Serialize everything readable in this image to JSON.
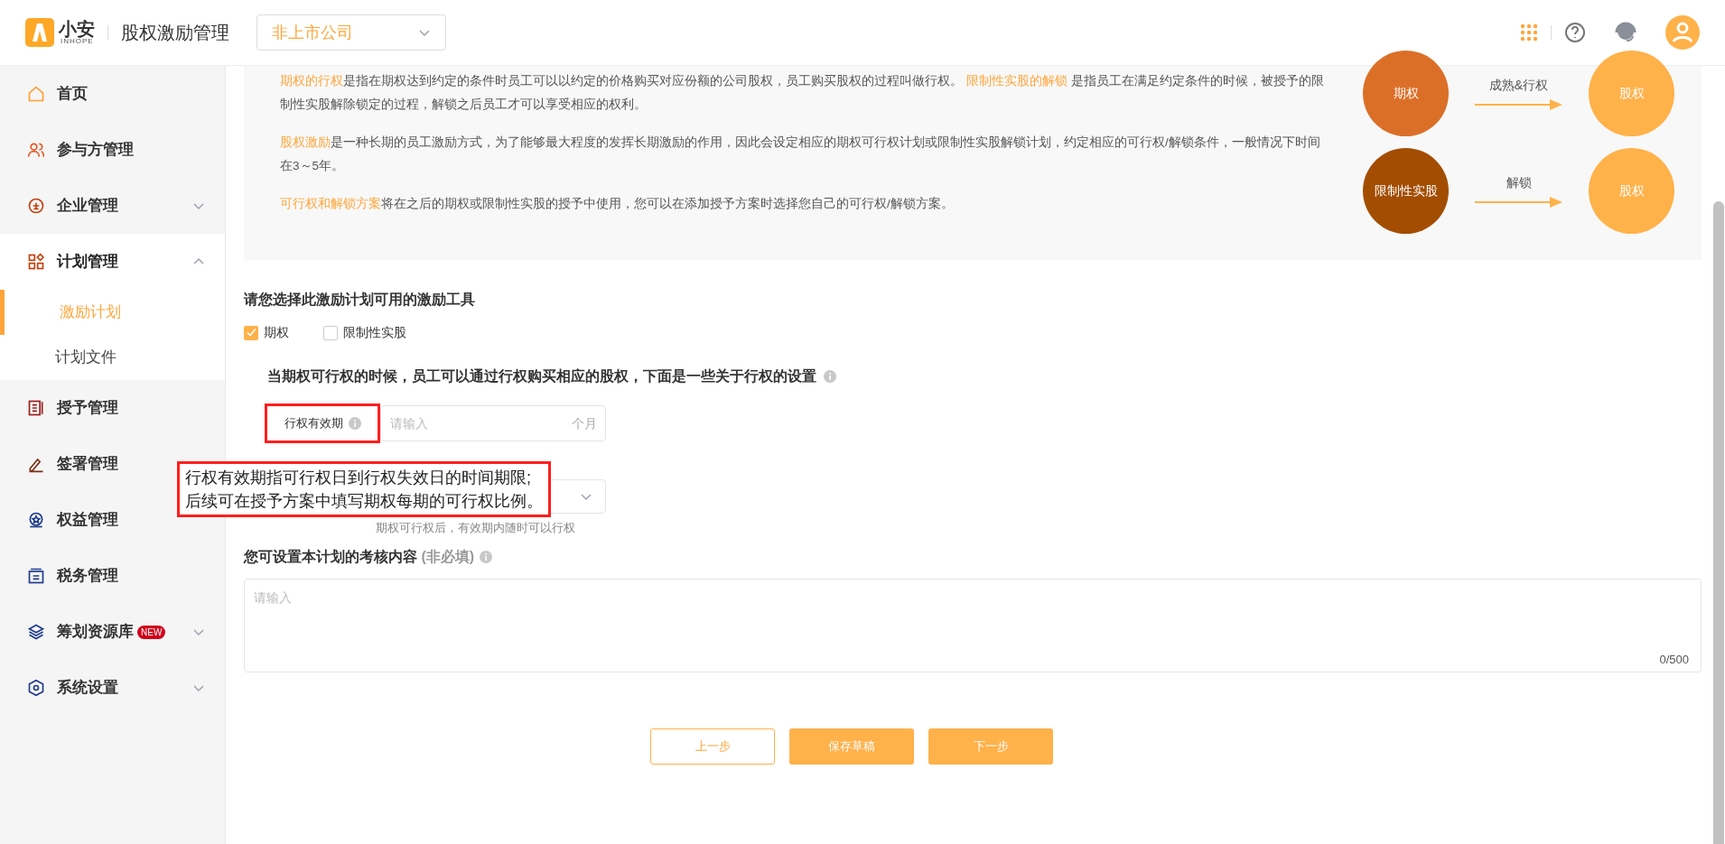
{
  "header": {
    "logo_text": "小安",
    "logo_sub": "INHOPE",
    "app_title": "股权激励管理",
    "company_select": "非上市公司"
  },
  "sidebar": [
    {
      "label": "首页",
      "selected": false
    },
    {
      "label": "参与方管理",
      "selected": false
    },
    {
      "label": "企业管理",
      "expanded": false,
      "selected": false
    },
    {
      "label": "计划管理",
      "expanded": true,
      "selected": false,
      "children": [
        {
          "label": "激励计划",
          "selected": true
        },
        {
          "label": "计划文件",
          "selected": false
        }
      ]
    },
    {
      "label": "授予管理",
      "selected": false
    },
    {
      "label": "签署管理",
      "expanded": false,
      "selected": false
    },
    {
      "label": "权益管理",
      "selected": false
    },
    {
      "label": "税务管理",
      "selected": false
    },
    {
      "label": "筹划资源库",
      "badge": "NEW",
      "expanded": false,
      "selected": false
    },
    {
      "label": "系统设置",
      "expanded": false,
      "selected": false
    }
  ],
  "intro": [
    [
      {
        "text": "期权的行权",
        "highlight": true
      },
      {
        "text": "是指在期权达到约定的条件时员工可以以约定的价格购买对应份额的公司股权，员工购买股权的过程叫做行权。 ",
        "highlight": false
      },
      {
        "text": "限制性实股的解锁",
        "highlight": true
      },
      {
        "text": " 是指员工在满足约定条件的时候，被授予的限制性实股解除锁定的过程，解锁之后员工才可以享受相应的权利。",
        "highlight": false
      }
    ],
    [
      {
        "text": "股权激励",
        "highlight": true
      },
      {
        "text": "是一种长期的员工激励方式，为了能够最大程度的发挥长期激励的作用，因此会设定相应的期权可行权计划或限制性实股解锁计划，约定相应的可行权/解锁条件，一般情况下时间在3～5年。",
        "highlight": false
      }
    ],
    [
      {
        "text": "可行权和解锁方案",
        "highlight": true
      },
      {
        "text": "将在之后的期权或限制性实股的授予中使用，您可以在添加授予方案时选择您自己的可行权/解锁方案。",
        "highlight": false
      }
    ]
  ],
  "diagram": [
    {
      "from": "期权",
      "arrow_label": "成熟&行权",
      "to": "股权"
    },
    {
      "from": "限制性实股",
      "arrow_label": "解锁",
      "to": "股权"
    }
  ],
  "tools": {
    "title": "请您选择此激励计划可用的激励工具",
    "options": [
      {
        "label": "期权",
        "checked": true
      },
      {
        "label": "限制性实股",
        "checked": false
      }
    ]
  },
  "exercise": {
    "title": "当期权可行权的时候，员工可以通过行权购买相应的股权，下面是一些关于行权的设置",
    "field_label": "行权有效期",
    "placeholder": "请输入",
    "suffix": "个月",
    "tooltip": [
      "行权有效期指可行权日到行权失效日的时间期限;",
      "后续可在授予方案中填写期权每期的可行权比例。"
    ],
    "select_hint": "期权可行权后，有效期内随时可以行权"
  },
  "assessment": {
    "title": "您可设置本计划的考核内容",
    "optional": "(非必填)",
    "placeholder": "请输入",
    "counter": "0/500"
  },
  "buttons": [
    {
      "label": "上一步",
      "kind": "outline"
    },
    {
      "label": "保存草稿",
      "kind": "primary"
    },
    {
      "label": "下一步",
      "kind": "primary"
    }
  ]
}
